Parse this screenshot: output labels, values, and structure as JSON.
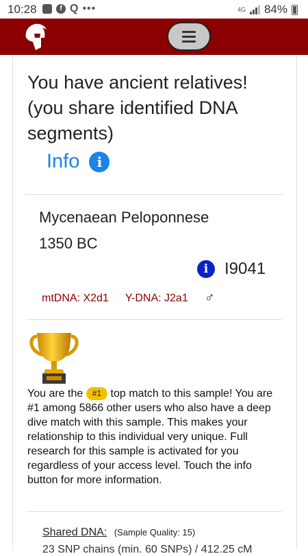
{
  "status_bar": {
    "time": "10:28",
    "network": "4G",
    "battery": "84%",
    "battery_level": 0.84
  },
  "colors": {
    "navbar": "#8b0000",
    "info_blue": "#1a84e8",
    "id_blue": "#0b21c8",
    "dna_red": "#8b0000",
    "badge_yellow": "#f2c200"
  },
  "navbar": {
    "logo_icon": "spartan-helmet-icon",
    "menu_icon": "hamburger-menu-icon"
  },
  "result": {
    "headline": "You have ancient relatives! (you share identified DNA segments)",
    "info_label": "Info",
    "info_icon_glyph": "i"
  },
  "sample": {
    "name_line1": "Mycenaean Peloponnese",
    "name_line2": "1350 BC",
    "id": "I9041",
    "id_icon_glyph": "i",
    "mtdna": "mtDNA: X2d1",
    "ydna": "Y-DNA: J2a1",
    "sex_symbol": "♂"
  },
  "match": {
    "intro_before": "You are the",
    "rank_badge": "#1",
    "intro_after": "top match to this sample!",
    "body": "You are #1 among 5866 other users who also have a deep dive match with this sample. This makes your relationship to this individual very unique. Full research for this sample is activated for you regardless of your access level. Touch the info button for more information."
  },
  "shared": {
    "label": "Shared DNA:",
    "quality": "(Sample Quality: 15)",
    "partial_line": "23 SNP chains (min. 60 SNPs) / 412.25 cM"
  }
}
